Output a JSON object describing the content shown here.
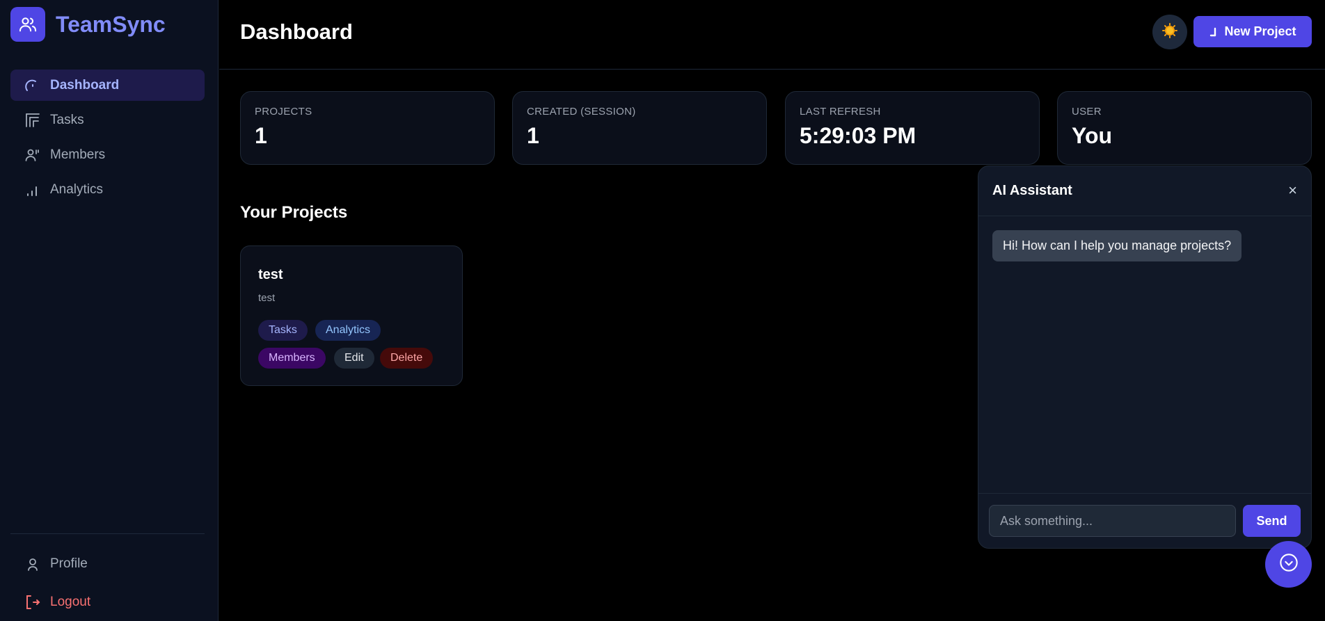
{
  "app": {
    "name": "TeamSync",
    "logo_icon": "users-icon",
    "accent": "#4f46e5"
  },
  "sidebar": {
    "items": [
      {
        "label": "Dashboard",
        "icon": "gauge-icon",
        "active": true
      },
      {
        "label": "Tasks",
        "icon": "kanban-icon"
      },
      {
        "label": "Members",
        "icon": "members-icon"
      },
      {
        "label": "Analytics",
        "icon": "bar-chart-icon"
      }
    ],
    "bottom": [
      {
        "label": "Profile",
        "icon": "user-icon"
      },
      {
        "label": "Logout",
        "icon": "logout-icon",
        "color": "#f87171"
      }
    ]
  },
  "header": {
    "title": "Dashboard",
    "theme_icon": "sun-icon",
    "new_project_label": "New Project"
  },
  "stats": [
    {
      "label": "PROJECTS",
      "value": "1"
    },
    {
      "label": "CREATED (SESSION)",
      "value": "1"
    },
    {
      "label": "LAST REFRESH",
      "value": "5:29:03 PM"
    },
    {
      "label": "USER",
      "value": "You"
    }
  ],
  "projects": {
    "section_title": "Your Projects",
    "items": [
      {
        "name": "test",
        "description": "test",
        "actions": [
          "Tasks",
          "Analytics",
          "Members",
          "Edit",
          "Delete"
        ]
      }
    ]
  },
  "ai_assistant": {
    "title": "AI Assistant",
    "close_label": "×",
    "messages": [
      {
        "role": "assistant",
        "text": "Hi! How can I help you manage projects?"
      }
    ],
    "input_placeholder": "Ask something...",
    "send_label": "Send"
  }
}
